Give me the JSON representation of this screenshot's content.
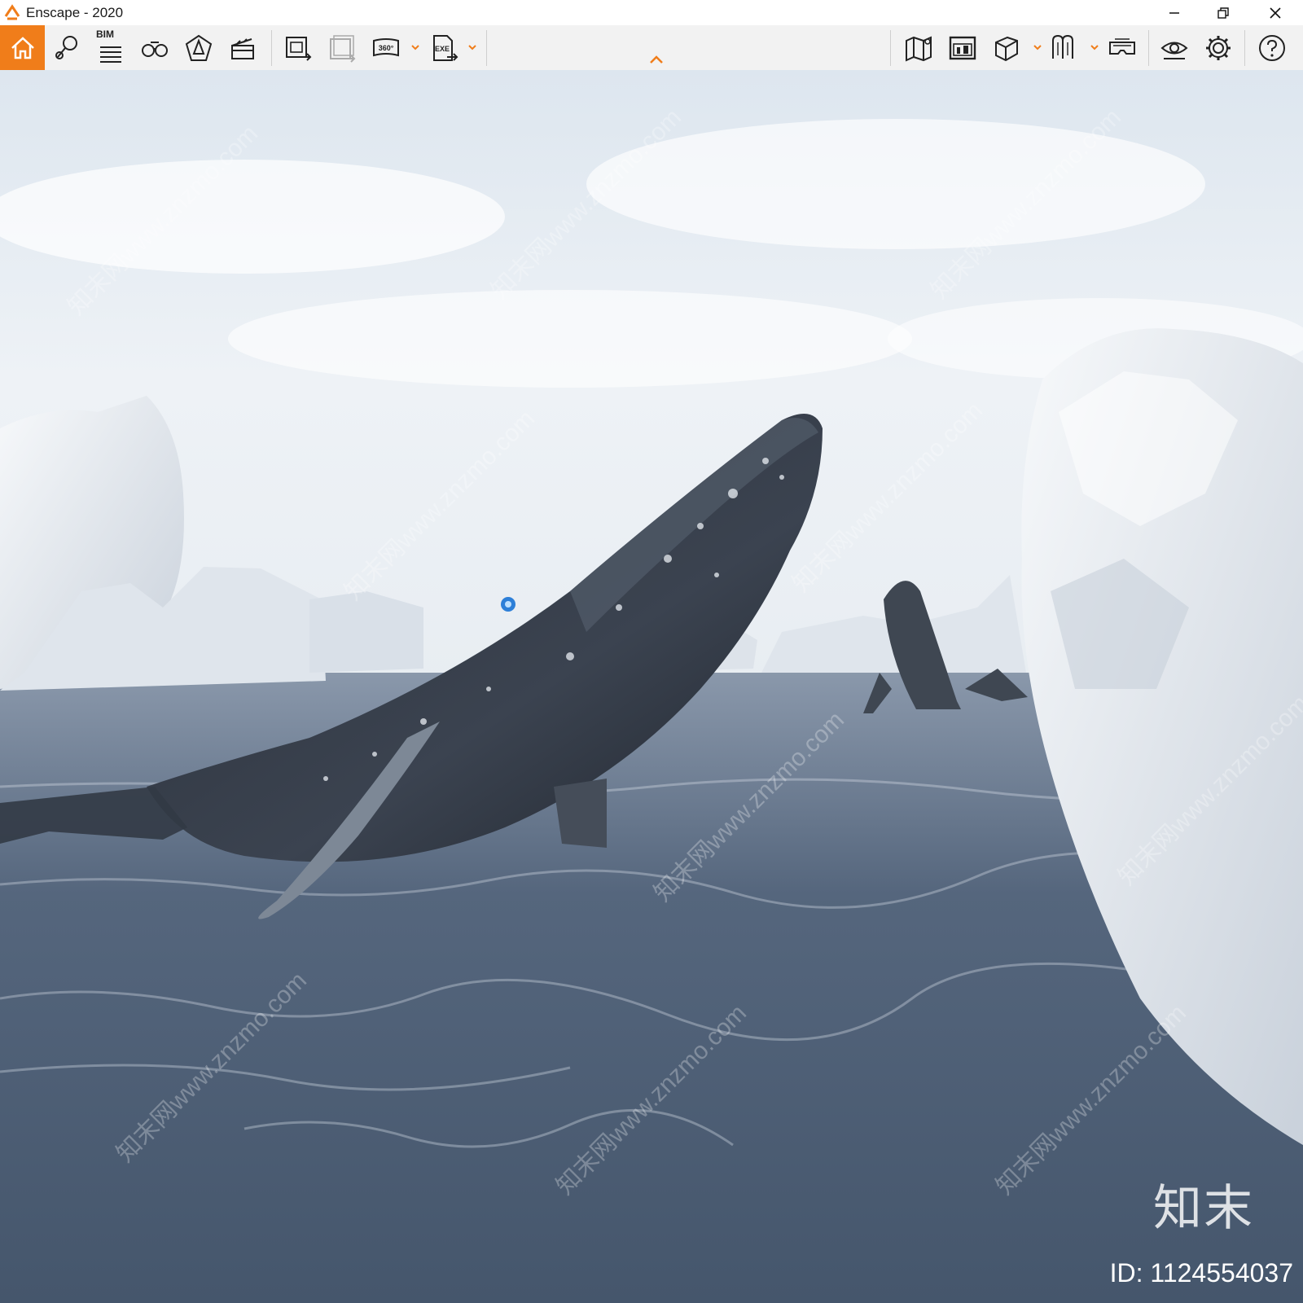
{
  "window": {
    "title": "Enscape - 2020",
    "accent_color": "#f07d1a",
    "controls": [
      "minimize-icon",
      "restore-icon",
      "close-icon"
    ]
  },
  "toolbar": {
    "left_group": [
      {
        "name": "home",
        "icon": "home-icon",
        "active": true
      },
      {
        "name": "views",
        "icon": "views-pin-icon"
      },
      {
        "name": "bim",
        "icon": "bim-list-icon",
        "label": "BIM"
      },
      {
        "name": "binoculars",
        "icon": "binoculars-icon"
      },
      {
        "name": "object-info",
        "icon": "light-cone-icon"
      },
      {
        "name": "video-editor",
        "icon": "clapperboard-icon"
      },
      {
        "name": "screenshot",
        "icon": "render-export-icon"
      },
      {
        "name": "batch-render",
        "icon": "batch-render-icon"
      },
      {
        "name": "panorama",
        "icon": "panorama-360-icon",
        "label": "360°",
        "dropdown": true
      },
      {
        "name": "export-exe",
        "icon": "exe-export-icon",
        "label": "EXE",
        "dropdown": true
      }
    ],
    "right_group": [
      {
        "name": "map",
        "icon": "map-icon"
      },
      {
        "name": "asset-library",
        "icon": "asset-library-icon"
      },
      {
        "name": "cube",
        "icon": "cube-icon",
        "dropdown": true
      },
      {
        "name": "materials",
        "icon": "materials-icon",
        "dropdown": true
      },
      {
        "name": "vr-headset",
        "icon": "vr-headset-icon"
      },
      {
        "name": "visual-settings",
        "icon": "eye-icon"
      },
      {
        "name": "general-settings",
        "icon": "gear-icon"
      },
      {
        "name": "help",
        "icon": "help-icon"
      }
    ],
    "collapse_icon": "chevron-up-icon"
  },
  "viewport": {
    "scene": "rendered-scene",
    "watermark": "知末网www.znzmo.com",
    "brand": "知末",
    "image_id": "ID: 1124554037",
    "colors": {
      "sky": "#e9eef3",
      "water": "#4c5d73",
      "ice": "#e6eaef"
    }
  }
}
